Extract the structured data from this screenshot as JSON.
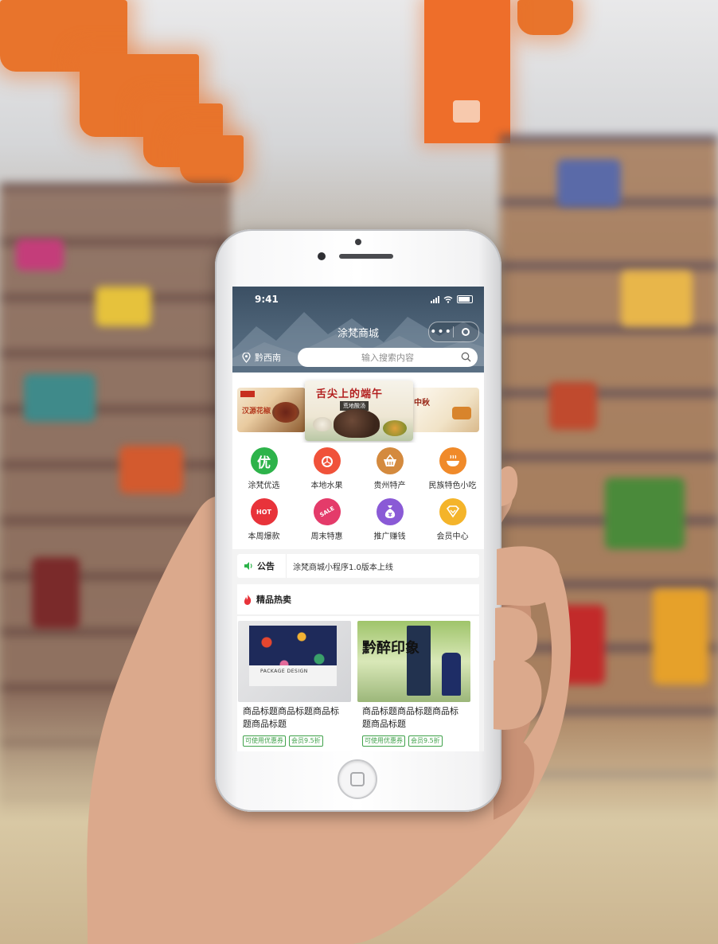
{
  "status_bar": {
    "time": "9:41"
  },
  "header": {
    "title": "涂梵商城",
    "capsule_menu": "•••",
    "location": "黔西南",
    "search_placeholder": "输入搜索内容"
  },
  "banner": {
    "slides": [
      {
        "caption": "汉源花椒"
      },
      {
        "caption": "舌尖上的端午",
        "subcaption": "荒地酸汤"
      },
      {
        "caption": "中秋"
      }
    ]
  },
  "categories": [
    {
      "label": "涂梵优选",
      "icon": "优",
      "color": "#2db34a"
    },
    {
      "label": "本地水果",
      "icon": "orange-icon",
      "color": "#f0523a"
    },
    {
      "label": "贵州特产",
      "icon": "basket-icon",
      "color": "#d48a3e"
    },
    {
      "label": "民族特色小吃",
      "icon": "bowl-icon",
      "color": "#f08a2a"
    },
    {
      "label": "本周爆款",
      "icon": "HOT",
      "color": "#e8333a"
    },
    {
      "label": "周末特惠",
      "icon": "SALE",
      "color": "#e43b6a"
    },
    {
      "label": "推广赚钱",
      "icon": "money-bag-icon",
      "color": "#8a5ad6"
    },
    {
      "label": "会员中心",
      "icon": "diamond-icon",
      "color": "#f4b42a"
    }
  ],
  "notice": {
    "label": "公告",
    "text": "涂梵商城小程序1.0版本上线"
  },
  "hot": {
    "title": "精品热卖",
    "products": [
      {
        "name": "商品标题商品标题商品标题商品标题",
        "image_text": "PACKAGE DESIGN",
        "tags": [
          "可使用优惠券",
          "会员9.5折"
        ]
      },
      {
        "name": "商品标题商品标题商品标题商品标题",
        "image_text": "黔醉印象",
        "tags": [
          "可使用优惠券",
          "会员9.5折"
        ]
      }
    ]
  }
}
